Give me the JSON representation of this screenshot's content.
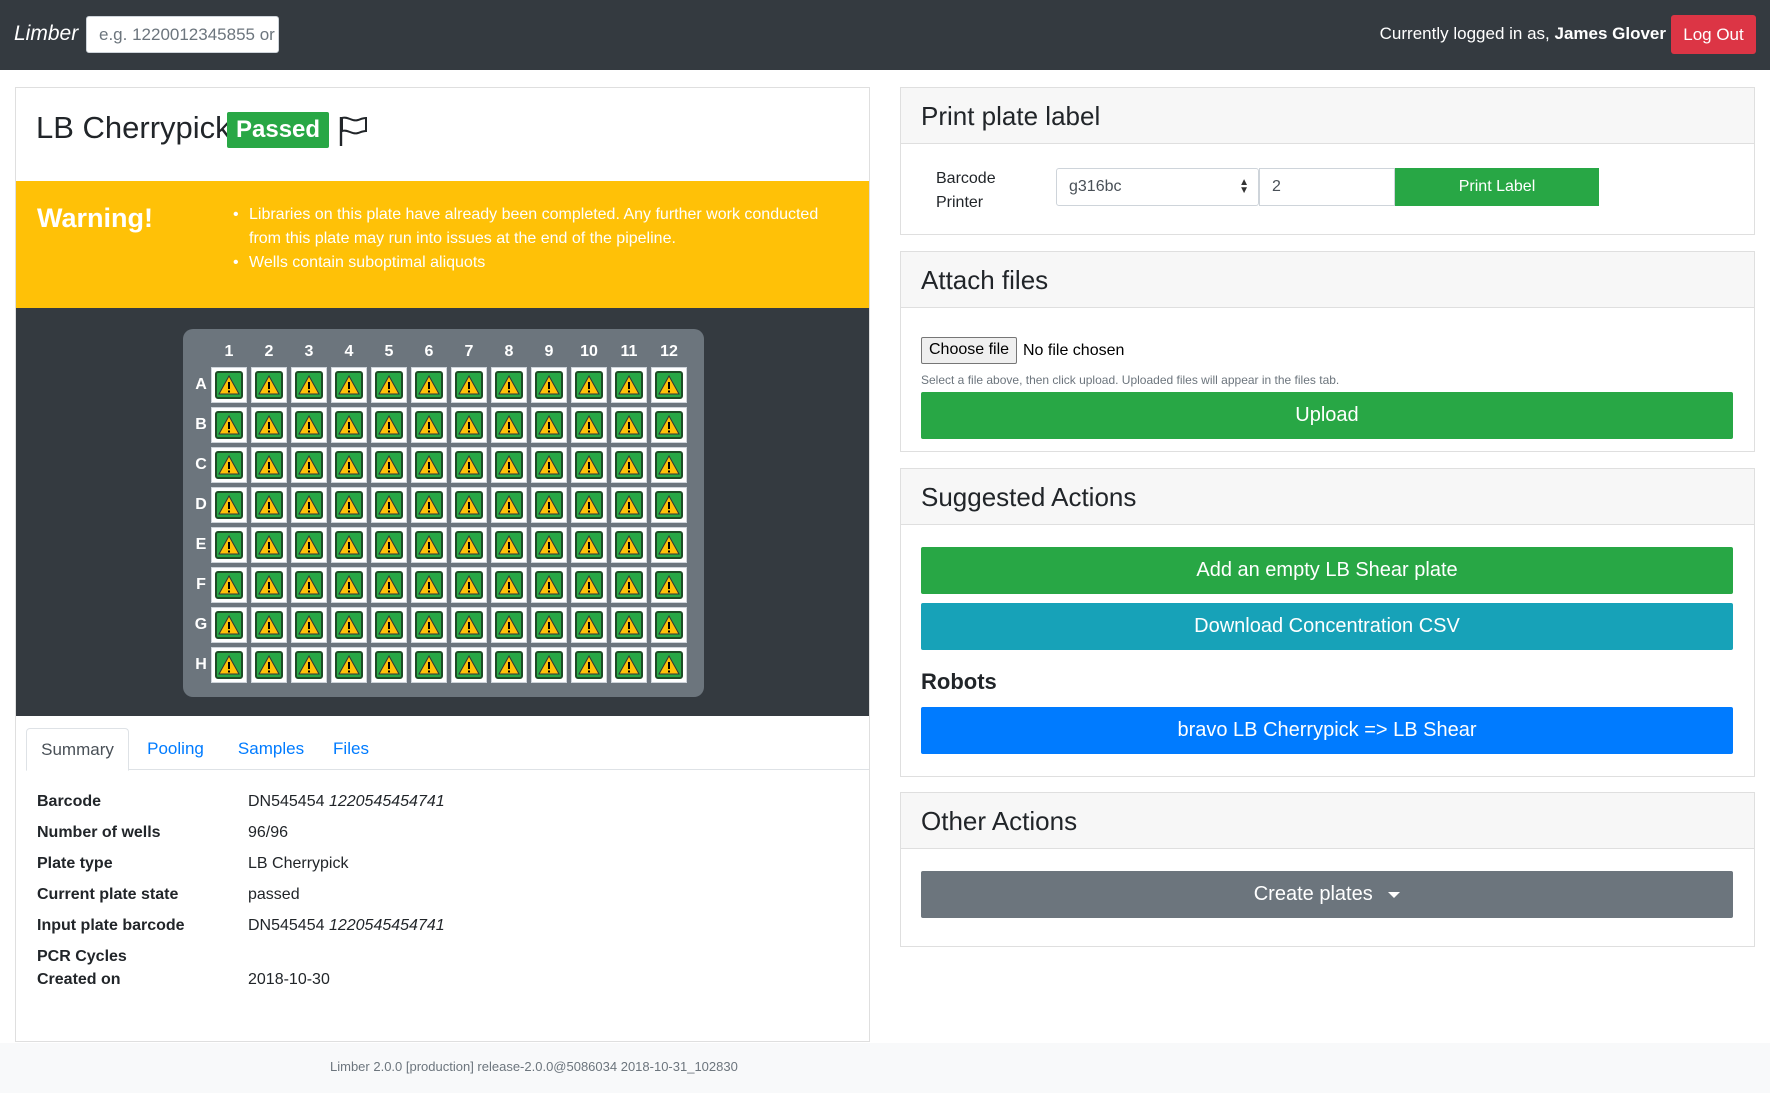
{
  "navbar": {
    "brand": "Limber",
    "search_placeholder": "e.g. 1220012345855 or",
    "login_prefix": "Currently logged in as, ",
    "user_name": "James Glover",
    "logout_label": "Log Out"
  },
  "plate": {
    "title": "LB Cherrypick",
    "state": "Passed",
    "warning": {
      "title": "Warning!",
      "items": [
        "Libraries on this plate have already been completed. Any further work conducted from this plate may run into issues at the end of the pipeline.",
        "Wells contain suboptimal aliquots"
      ]
    },
    "columns": [
      "1",
      "2",
      "3",
      "4",
      "5",
      "6",
      "7",
      "8",
      "9",
      "10",
      "11",
      "12"
    ],
    "rows": [
      "A",
      "B",
      "C",
      "D",
      "E",
      "F",
      "G",
      "H"
    ],
    "well_icon": "warning-icon",
    "colors": {
      "well_fill": "#28a745",
      "icon_fill": "#ffc107",
      "plate_bg": "#6c757d"
    }
  },
  "tabs": [
    "Summary",
    "Pooling",
    "Samples",
    "Files"
  ],
  "summary": {
    "rows": [
      {
        "key": "Barcode",
        "value": "DN545454",
        "value_italic": "1220545454741"
      },
      {
        "key": "Number of wells",
        "value": "96/96",
        "value_italic": ""
      },
      {
        "key": "Plate type",
        "value": "LB Cherrypick",
        "value_italic": ""
      },
      {
        "key": "Current plate state",
        "value": "passed",
        "value_italic": ""
      },
      {
        "key": "Input plate barcode",
        "value": "DN545454",
        "value_italic": "1220545454741"
      },
      {
        "key": "PCR Cycles",
        "value": "",
        "value_italic": ""
      },
      {
        "key": "Created on",
        "value": "2018-10-30",
        "value_italic": ""
      }
    ]
  },
  "print_card": {
    "title": "Print plate label",
    "printer_label_1": "Barcode",
    "printer_label_2": "Printer",
    "printer_selected": "g316bc",
    "copies": "2",
    "print_label": "Print Label"
  },
  "attach_card": {
    "title": "Attach files",
    "choose_file": "Choose file",
    "no_file": "No file chosen",
    "help": "Select a file above, then click upload. Uploaded files will appear in the files tab.",
    "upload": "Upload"
  },
  "suggested_card": {
    "title": "Suggested Actions",
    "add_plate": "Add an empty LB Shear plate",
    "download_csv": "Download Concentration CSV",
    "robots_heading": "Robots",
    "robot_button": "bravo LB Cherrypick => LB Shear"
  },
  "other_card": {
    "title": "Other Actions",
    "create_plates": "Create plates"
  },
  "footer": {
    "text": "Limber 2.0.0 [production] release-2.0.0@5086034 2018-10-31_102830"
  },
  "theme": {
    "success": "#28a745",
    "danger": "#dc3545",
    "info": "#17a2b8",
    "primary": "#007bff",
    "secondary": "#6c757d",
    "warning": "#ffc107",
    "dark": "#343a40"
  }
}
